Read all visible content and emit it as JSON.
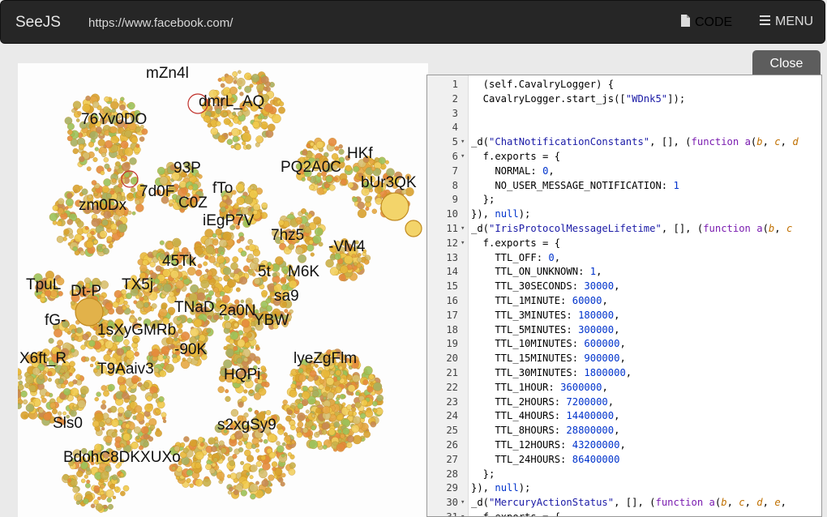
{
  "app": {
    "brand": "SeeJS",
    "url": "https://www.facebook.com/",
    "code_label": "CODE",
    "menu_label": "MENU",
    "code_icon": "file-icon",
    "menu_icon": "hamburger-icon",
    "close_label": "Close"
  },
  "viz": {
    "labels": [
      "mZn4l",
      "dmrL_AQ",
      "76Yv0DO",
      "HKf",
      "PQ2A0C",
      "bUr3QK",
      "93P",
      "7d0F",
      "fTo",
      "C0Z",
      "zm0Dx",
      "iEgP7V",
      "7hz5",
      "-VM4",
      "45Tk",
      "5t",
      "M6K",
      "TpuL",
      "Dt-P",
      "TX5j",
      "sa9",
      "fG-",
      "TNaD",
      "2a0N",
      "YBW",
      "1sXyGMRb",
      "-90K",
      "X6ft_R",
      "T9Aaiv3",
      "HQPi",
      "lyeZgFlm",
      "Sls0",
      "s2xgSy9",
      "BdohC8DKXUXo"
    ]
  },
  "editor": {
    "lines": [
      {
        "n": "1",
        "f": "",
        "t": [
          [
            "",
            "  (self.CavalryLogger) {"
          ]
        ]
      },
      {
        "n": "2",
        "f": "",
        "t": [
          [
            "",
            "  CavalryLogger.start_js(["
          ],
          [
            "s",
            "\"WDnk5\""
          ],
          [
            "",
            "]);"
          ]
        ]
      },
      {
        "n": "3",
        "f": "",
        "t": [
          [
            "",
            ""
          ]
        ]
      },
      {
        "n": "4",
        "f": "",
        "t": [
          [
            "",
            ""
          ]
        ]
      },
      {
        "n": "5",
        "f": "▾",
        "t": [
          [
            "",
            "_d("
          ],
          [
            "s",
            "\"ChatNotificationConstants\""
          ],
          [
            "",
            ", [], ("
          ],
          [
            "k",
            "function"
          ],
          [
            "",
            " "
          ],
          [
            "k",
            "a"
          ],
          [
            "",
            "("
          ],
          [
            "p",
            "b"
          ],
          [
            "",
            ", "
          ],
          [
            "p",
            "c"
          ],
          [
            "",
            ", "
          ],
          [
            "p",
            "d"
          ]
        ]
      },
      {
        "n": "6",
        "f": "▾",
        "t": [
          [
            "",
            "  f.exports = {"
          ]
        ]
      },
      {
        "n": "7",
        "f": "",
        "t": [
          [
            "",
            "    NORMAL: "
          ],
          [
            "n",
            "0"
          ],
          [
            "",
            ","
          ]
        ]
      },
      {
        "n": "8",
        "f": "",
        "t": [
          [
            "",
            "    NO_USER_MESSAGE_NOTIFICATION: "
          ],
          [
            "n",
            "1"
          ]
        ]
      },
      {
        "n": "9",
        "f": "",
        "t": [
          [
            "",
            "  };"
          ]
        ]
      },
      {
        "n": "10",
        "f": "",
        "t": [
          [
            "",
            "}), "
          ],
          [
            "n",
            "null"
          ],
          [
            "",
            ");"
          ]
        ]
      },
      {
        "n": "11",
        "f": "▾",
        "t": [
          [
            "",
            "_d("
          ],
          [
            "s",
            "\"IrisProtocolMessageLifetime\""
          ],
          [
            "",
            ", [], ("
          ],
          [
            "k",
            "function"
          ],
          [
            "",
            " "
          ],
          [
            "k",
            "a"
          ],
          [
            "",
            "("
          ],
          [
            "p",
            "b"
          ],
          [
            "",
            ", "
          ],
          [
            "p",
            "c"
          ]
        ]
      },
      {
        "n": "12",
        "f": "▾",
        "t": [
          [
            "",
            "  f.exports = {"
          ]
        ]
      },
      {
        "n": "13",
        "f": "",
        "t": [
          [
            "",
            "    TTL_OFF: "
          ],
          [
            "n",
            "0"
          ],
          [
            "",
            ","
          ]
        ]
      },
      {
        "n": "14",
        "f": "",
        "t": [
          [
            "",
            "    TTL_ON_UNKNOWN: "
          ],
          [
            "n",
            "1"
          ],
          [
            "",
            ","
          ]
        ]
      },
      {
        "n": "15",
        "f": "",
        "t": [
          [
            "",
            "    TTL_30SECONDS: "
          ],
          [
            "n",
            "30000"
          ],
          [
            "",
            ","
          ]
        ]
      },
      {
        "n": "16",
        "f": "",
        "t": [
          [
            "",
            "    TTL_1MINUTE: "
          ],
          [
            "n",
            "60000"
          ],
          [
            "",
            ","
          ]
        ]
      },
      {
        "n": "17",
        "f": "",
        "t": [
          [
            "",
            "    TTL_3MINUTES: "
          ],
          [
            "n",
            "180000"
          ],
          [
            "",
            ","
          ]
        ]
      },
      {
        "n": "18",
        "f": "",
        "t": [
          [
            "",
            "    TTL_5MINUTES: "
          ],
          [
            "n",
            "300000"
          ],
          [
            "",
            ","
          ]
        ]
      },
      {
        "n": "19",
        "f": "",
        "t": [
          [
            "",
            "    TTL_10MINUTES: "
          ],
          [
            "n",
            "600000"
          ],
          [
            "",
            ","
          ]
        ]
      },
      {
        "n": "20",
        "f": "",
        "t": [
          [
            "",
            "    TTL_15MINUTES: "
          ],
          [
            "n",
            "900000"
          ],
          [
            "",
            ","
          ]
        ]
      },
      {
        "n": "21",
        "f": "",
        "t": [
          [
            "",
            "    TTL_30MINUTES: "
          ],
          [
            "n",
            "1800000"
          ],
          [
            "",
            ","
          ]
        ]
      },
      {
        "n": "22",
        "f": "",
        "t": [
          [
            "",
            "    TTL_1HOUR: "
          ],
          [
            "n",
            "3600000"
          ],
          [
            "",
            ","
          ]
        ]
      },
      {
        "n": "23",
        "f": "",
        "t": [
          [
            "",
            "    TTL_2HOURS: "
          ],
          [
            "n",
            "7200000"
          ],
          [
            "",
            ","
          ]
        ]
      },
      {
        "n": "24",
        "f": "",
        "t": [
          [
            "",
            "    TTL_4HOURS: "
          ],
          [
            "n",
            "14400000"
          ],
          [
            "",
            ","
          ]
        ]
      },
      {
        "n": "25",
        "f": "",
        "t": [
          [
            "",
            "    TTL_8HOURS: "
          ],
          [
            "n",
            "28800000"
          ],
          [
            "",
            ","
          ]
        ]
      },
      {
        "n": "26",
        "f": "",
        "t": [
          [
            "",
            "    TTL_12HOURS: "
          ],
          [
            "n",
            "43200000"
          ],
          [
            "",
            ","
          ]
        ]
      },
      {
        "n": "27",
        "f": "",
        "t": [
          [
            "",
            "    TTL_24HOURS: "
          ],
          [
            "n",
            "86400000"
          ]
        ]
      },
      {
        "n": "28",
        "f": "",
        "t": [
          [
            "",
            "  };"
          ]
        ]
      },
      {
        "n": "29",
        "f": "",
        "t": [
          [
            "",
            "}), "
          ],
          [
            "n",
            "null"
          ],
          [
            "",
            ");"
          ]
        ]
      },
      {
        "n": "30",
        "f": "▾",
        "t": [
          [
            "",
            "_d("
          ],
          [
            "s",
            "\"MercuryActionStatus\""
          ],
          [
            "",
            ", [], ("
          ],
          [
            "k",
            "function"
          ],
          [
            "",
            " "
          ],
          [
            "k",
            "a"
          ],
          [
            "",
            "("
          ],
          [
            "p",
            "b"
          ],
          [
            "",
            ", "
          ],
          [
            "p",
            "c"
          ],
          [
            "",
            ", "
          ],
          [
            "p",
            "d"
          ],
          [
            "",
            ", "
          ],
          [
            "p",
            "e"
          ],
          [
            "",
            ","
          ]
        ]
      },
      {
        "n": "31",
        "f": "▾",
        "t": [
          [
            "",
            "  f.exports = {"
          ]
        ]
      }
    ]
  }
}
